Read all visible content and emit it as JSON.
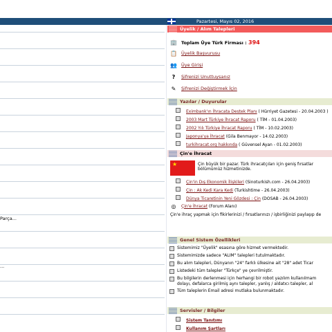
{
  "header": {
    "date": "Pazartesi, Mayıs 02, 2016"
  },
  "left": {
    "parca_text": "Parça...",
    "dots_text": "..."
  },
  "membership": {
    "title": "Üyelik / Alım Talepleri",
    "total_label": "Toplam Üye Türk Firması :",
    "total_value": "394",
    "links": [
      "Üyelik Başvurusu",
      "Üye Girişi",
      "Şifrenizi Unuttuysanız",
      "Şifrenizi Değiştirmek İçin"
    ]
  },
  "news": {
    "title": "Yazılar / Duyurular",
    "items": [
      {
        "title": "Eximbank'ın İhracata Destek Planı",
        "source": " ( Hürriyet Gazetesi - 20.04.2003 )"
      },
      {
        "title": "2003 Mart Türkiye İhracat Raporu",
        "source": " ( TİM - 01.04.2003)"
      },
      {
        "title": "2002 Yılı Türkiye İhracat Raporu",
        "source": " ( TİM - 10.02.2003)"
      },
      {
        "title": "Japonya'ya İhracat",
        "source": " (Gila Benmayor - 14.02.2003)"
      },
      {
        "title": "turkihracat.org hakkında",
        "source": " ( Güvensel Ayan - 01.02.2003)"
      }
    ]
  },
  "china": {
    "title": "Çin'e İhracat",
    "intro": "Çin büyük bir pazar. Türk ihracatçıları için geniş fırsatlar bölümümüz hizmetinizde.",
    "items": [
      {
        "title": "Çin'in Dış Ekonomik İlişkileri",
        "source": " (Sinoturkish.com - 26.04.2003)"
      },
      {
        "title": "Çin : Ak Kedi Kara Kedi",
        "source": " (Turkishtime - 26.04.2003)"
      },
      {
        "title": "Dünya Ticaretinin Yeni Gözdesi : Çin",
        "source": " (DOSAB - 26.04.2003)"
      }
    ],
    "forum_link": "Çin'e İhracat",
    "forum_suffix": " (Forum Alanı)",
    "note": "Çin'e ihraç yapmak için fikirlerinizi / fırsatlarınızı / işbirliğinizi paylaşıp de"
  },
  "features": {
    "title": "Genel Sistem Özellikleri",
    "items": [
      "Sistemimiz \"Üyelik\" esasına göre hizmet vermektedir.",
      "Sistemimizde sadece \"ALIM\" talepleri tutulmaktadır.",
      "Bu alım talepleri, Dünyanın \"24\" farklı ülkesine ait \"28\" adet Ticar",
      "Listedeki tüm talepler \"Türkçe\" ye çevrilmiştir.",
      "Bu bilgilerin derlenmesi için herhangi bir robot yazılım kullanılmam",
      "dolayı, defalarca girilmiş aynı talepler, yanlış / aldatıcı talepler, al",
      "Tüm taleplerin Email adresi mutlaka bulunmaktadır."
    ]
  },
  "services": {
    "title": "Servisler / Bilgiler",
    "links": [
      "Sistem Tanıtımı",
      "Kullanım Şartları"
    ]
  }
}
